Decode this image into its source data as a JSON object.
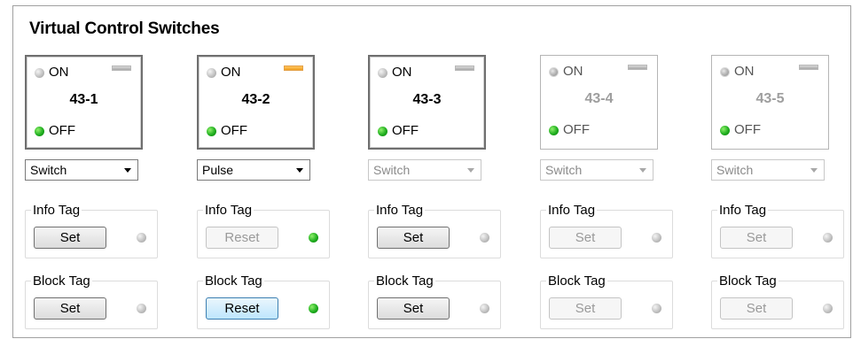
{
  "panel": {
    "title": "Virtual Control Switches"
  },
  "switches": [
    {
      "name": "43-1",
      "on_label": "ON",
      "off_label": "OFF",
      "on_indicator": "grey",
      "off_indicator": "green",
      "bar": "grey",
      "enabled": true,
      "mode": "Switch",
      "mode_enabled": true,
      "info": {
        "label": "Info Tag",
        "button": "Set",
        "button_state": "normal",
        "indicator": "grey"
      },
      "block": {
        "label": "Block Tag",
        "button": "Set",
        "button_state": "normal",
        "indicator": "grey"
      }
    },
    {
      "name": "43-2",
      "on_label": "ON",
      "off_label": "OFF",
      "on_indicator": "grey",
      "off_indicator": "green",
      "bar": "orange",
      "enabled": true,
      "mode": "Pulse",
      "mode_enabled": true,
      "info": {
        "label": "Info Tag",
        "button": "Reset",
        "button_state": "disabled",
        "indicator": "green"
      },
      "block": {
        "label": "Block Tag",
        "button": "Reset",
        "button_state": "focused",
        "indicator": "green"
      }
    },
    {
      "name": "43-3",
      "on_label": "ON",
      "off_label": "OFF",
      "on_indicator": "grey",
      "off_indicator": "green",
      "bar": "grey",
      "enabled": true,
      "mode": "Switch",
      "mode_enabled": false,
      "info": {
        "label": "Info Tag",
        "button": "Set",
        "button_state": "normal",
        "indicator": "grey"
      },
      "block": {
        "label": "Block Tag",
        "button": "Set",
        "button_state": "normal",
        "indicator": "grey"
      }
    },
    {
      "name": "43-4",
      "on_label": "ON",
      "off_label": "OFF",
      "on_indicator": "grey",
      "off_indicator": "green",
      "bar": "grey",
      "enabled": false,
      "mode": "Switch",
      "mode_enabled": false,
      "info": {
        "label": "Info Tag",
        "button": "Set",
        "button_state": "disabled",
        "indicator": "grey"
      },
      "block": {
        "label": "Block Tag",
        "button": "Set",
        "button_state": "disabled",
        "indicator": "grey"
      }
    },
    {
      "name": "43-5",
      "on_label": "ON",
      "off_label": "OFF",
      "on_indicator": "grey",
      "off_indicator": "green",
      "bar": "grey",
      "enabled": false,
      "mode": "Switch",
      "mode_enabled": false,
      "info": {
        "label": "Info Tag",
        "button": "Set",
        "button_state": "disabled",
        "indicator": "grey"
      },
      "block": {
        "label": "Block Tag",
        "button": "Set",
        "button_state": "disabled",
        "indicator": "grey"
      }
    }
  ],
  "colors": {
    "indicator_green": "#1fae1f",
    "indicator_grey": "#bdbdbd",
    "bar_orange": "#f0a020",
    "focus_blue": "#3c7fb1"
  }
}
